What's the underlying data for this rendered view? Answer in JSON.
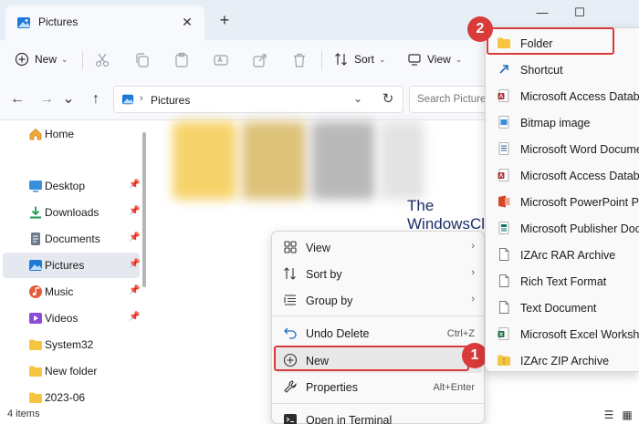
{
  "window": {
    "tab_title": "Pictures",
    "close_tab": "✕",
    "new_tab": "+",
    "minimize": "—",
    "maximize": "☐"
  },
  "toolbar": {
    "new_label": "New",
    "sort_label": "Sort",
    "view_label": "View"
  },
  "address": {
    "location": "Pictures",
    "search_placeholder": "Search Pictures"
  },
  "sidebar": {
    "home": "Home",
    "items": [
      {
        "label": "Desktop",
        "icon": "desktop-icon"
      },
      {
        "label": "Downloads",
        "icon": "downloads-icon"
      },
      {
        "label": "Documents",
        "icon": "documents-icon"
      },
      {
        "label": "Pictures",
        "icon": "pictures-icon"
      },
      {
        "label": "Music",
        "icon": "music-icon"
      },
      {
        "label": "Videos",
        "icon": "videos-icon"
      },
      {
        "label": "System32",
        "icon": "folder-icon"
      },
      {
        "label": "New folder",
        "icon": "folder-icon"
      },
      {
        "label": "2023-06",
        "icon": "folder-icon"
      }
    ]
  },
  "status": {
    "item_count": "4 items"
  },
  "watermark": {
    "line1": "The",
    "line2": "WindowsClub"
  },
  "context_menu": {
    "items": [
      {
        "label": "View",
        "icon": "view-grid-icon"
      },
      {
        "label": "Sort by",
        "icon": "sort-icon"
      },
      {
        "label": "Group by",
        "icon": "group-icon"
      },
      {
        "label": "Undo Delete",
        "icon": "undo-icon",
        "shortcut": "Ctrl+Z"
      },
      {
        "label": "New",
        "icon": "new-plus-icon"
      },
      {
        "label": "Properties",
        "icon": "properties-icon",
        "shortcut": "Alt+Enter"
      },
      {
        "label": "Open in Terminal",
        "icon": "terminal-icon"
      }
    ]
  },
  "new_submenu": {
    "items": [
      {
        "label": "Folder",
        "icon": "folder-icon"
      },
      {
        "label": "Shortcut",
        "icon": "shortcut-icon"
      },
      {
        "label": "Microsoft Access Database",
        "icon": "access-icon"
      },
      {
        "label": "Bitmap image",
        "icon": "bitmap-icon"
      },
      {
        "label": "Microsoft Word Document",
        "icon": "word-icon"
      },
      {
        "label": "Microsoft Access Database",
        "icon": "access-icon"
      },
      {
        "label": "Microsoft PowerPoint Presentation",
        "icon": "powerpoint-icon"
      },
      {
        "label": "Microsoft Publisher Document",
        "icon": "publisher-icon"
      },
      {
        "label": "IZArc RAR Archive",
        "icon": "rar-icon"
      },
      {
        "label": "Rich Text Format",
        "icon": "rtf-icon"
      },
      {
        "label": "Text Document",
        "icon": "text-icon"
      },
      {
        "label": "Microsoft Excel Worksheet",
        "icon": "excel-icon"
      },
      {
        "label": "IZArc ZIP Archive",
        "icon": "zip-icon"
      }
    ]
  },
  "callouts": {
    "step1": "1",
    "step2": "2"
  },
  "colors": {
    "accent": "#0067c0",
    "highlight": "#d93a3a",
    "folder": "#f5c542"
  }
}
